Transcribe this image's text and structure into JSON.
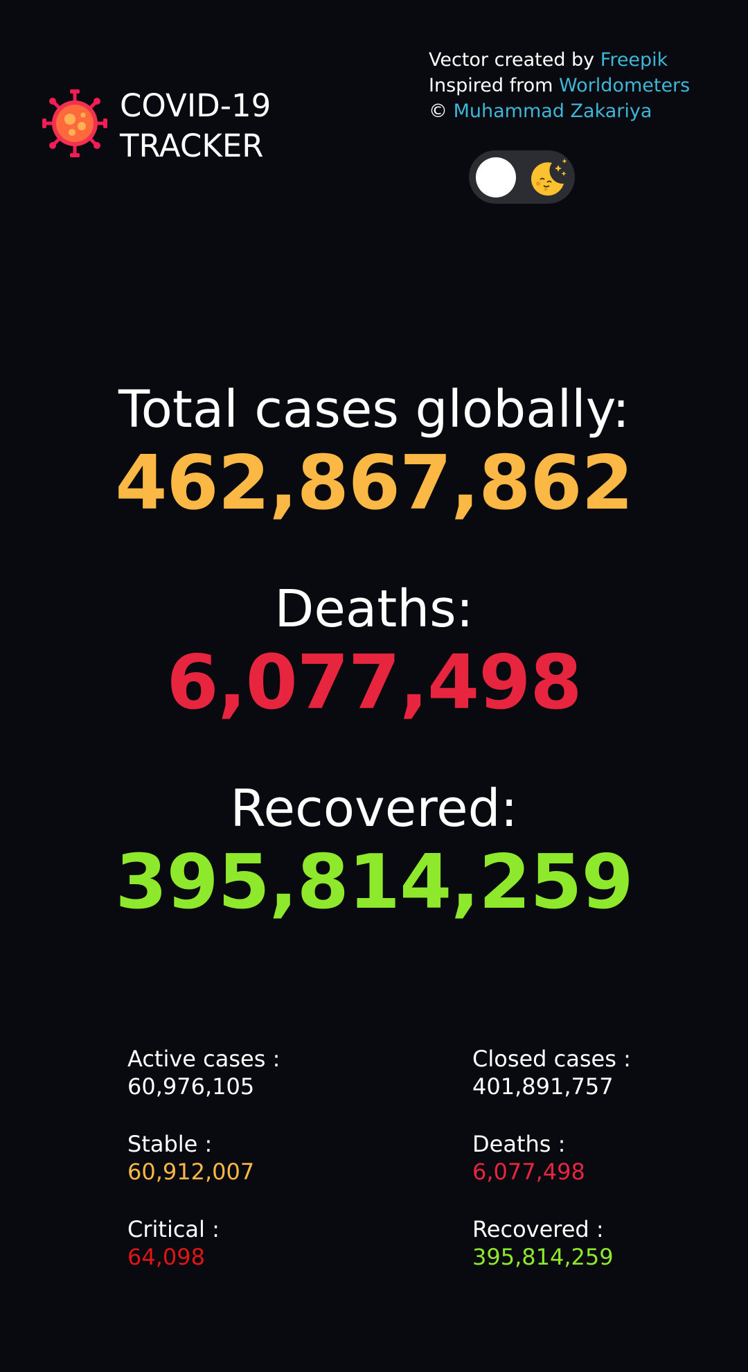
{
  "header": {
    "title_line1": "COVID-19",
    "title_line2": "TRACKER",
    "credits": {
      "vector_prefix": "Vector created by ",
      "vector_link": "Freepik",
      "inspired_prefix": "Inspired from ",
      "inspired_link": "Worldometers",
      "copyright_prefix": "© ",
      "author_link": "Muhammad Zakariya"
    },
    "theme_toggle_icon": "moon-icon"
  },
  "colors": {
    "background": "#080a10",
    "text": "#ffffff",
    "link": "#3fb6d8",
    "cases": "#fbb845",
    "deaths": "#e8253f",
    "recovered": "#8ee82b",
    "critical": "#e01515"
  },
  "summary": {
    "total_label": "Total cases globally:",
    "total_value": "462,867,862",
    "deaths_label": "Deaths:",
    "deaths_value": "6,077,498",
    "recovered_label": "Recovered:",
    "recovered_value": "395,814,259"
  },
  "details": {
    "active": {
      "label": "Active cases :",
      "value": "60,976,105",
      "stable_label": "Stable :",
      "stable_value": "60,912,007",
      "critical_label": "Critical :",
      "critical_value": "64,098"
    },
    "closed": {
      "label": "Closed cases :",
      "value": "401,891,757",
      "deaths_label": "Deaths :",
      "deaths_value": "6,077,498",
      "recovered_label": "Recovered :",
      "recovered_value": "395,814,259"
    }
  }
}
